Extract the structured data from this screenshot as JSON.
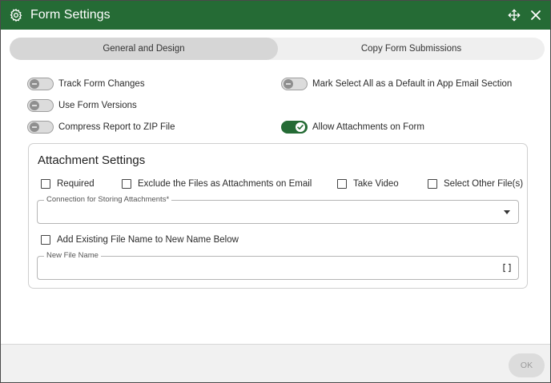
{
  "window": {
    "title": "Form Settings",
    "icons": {
      "settings": "gear-icon",
      "move": "move-arrows-icon",
      "close": "close-icon"
    },
    "accent_color": "#256b35"
  },
  "tabs": [
    {
      "label": "General and Design",
      "selected": true
    },
    {
      "label": "Copy Form Submissions",
      "selected": false
    }
  ],
  "toggles": {
    "track_form_changes": {
      "label": "Track Form Changes",
      "on": false
    },
    "use_form_versions": {
      "label": "Use Form Versions",
      "on": false
    },
    "compress_report": {
      "label": "Compress Report to ZIP File",
      "on": false
    },
    "mark_select_all": {
      "label": "Mark Select All as a Default in App Email Section",
      "on": false
    },
    "allow_attachments": {
      "label": "Allow Attachments on Form",
      "on": true
    }
  },
  "attachment_settings": {
    "title": "Attachment Settings",
    "checkboxes": {
      "required": {
        "label": "Required",
        "checked": false
      },
      "exclude_files": {
        "label": "Exclude the Files as Attachments on Email",
        "checked": false
      },
      "take_video": {
        "label": "Take Video",
        "checked": false
      },
      "select_other": {
        "label": "Select Other File(s)",
        "checked": false
      },
      "add_existing_name": {
        "label": "Add Existing File Name to New Name Below",
        "checked": false
      }
    },
    "connection_field": {
      "label": "Connection for Storing Attachments*",
      "value": ""
    },
    "new_file_name_field": {
      "label": "New File Name",
      "value": "",
      "icon": "brackets-icon"
    }
  },
  "footer": {
    "ok_label": "OK",
    "ok_enabled": false
  }
}
